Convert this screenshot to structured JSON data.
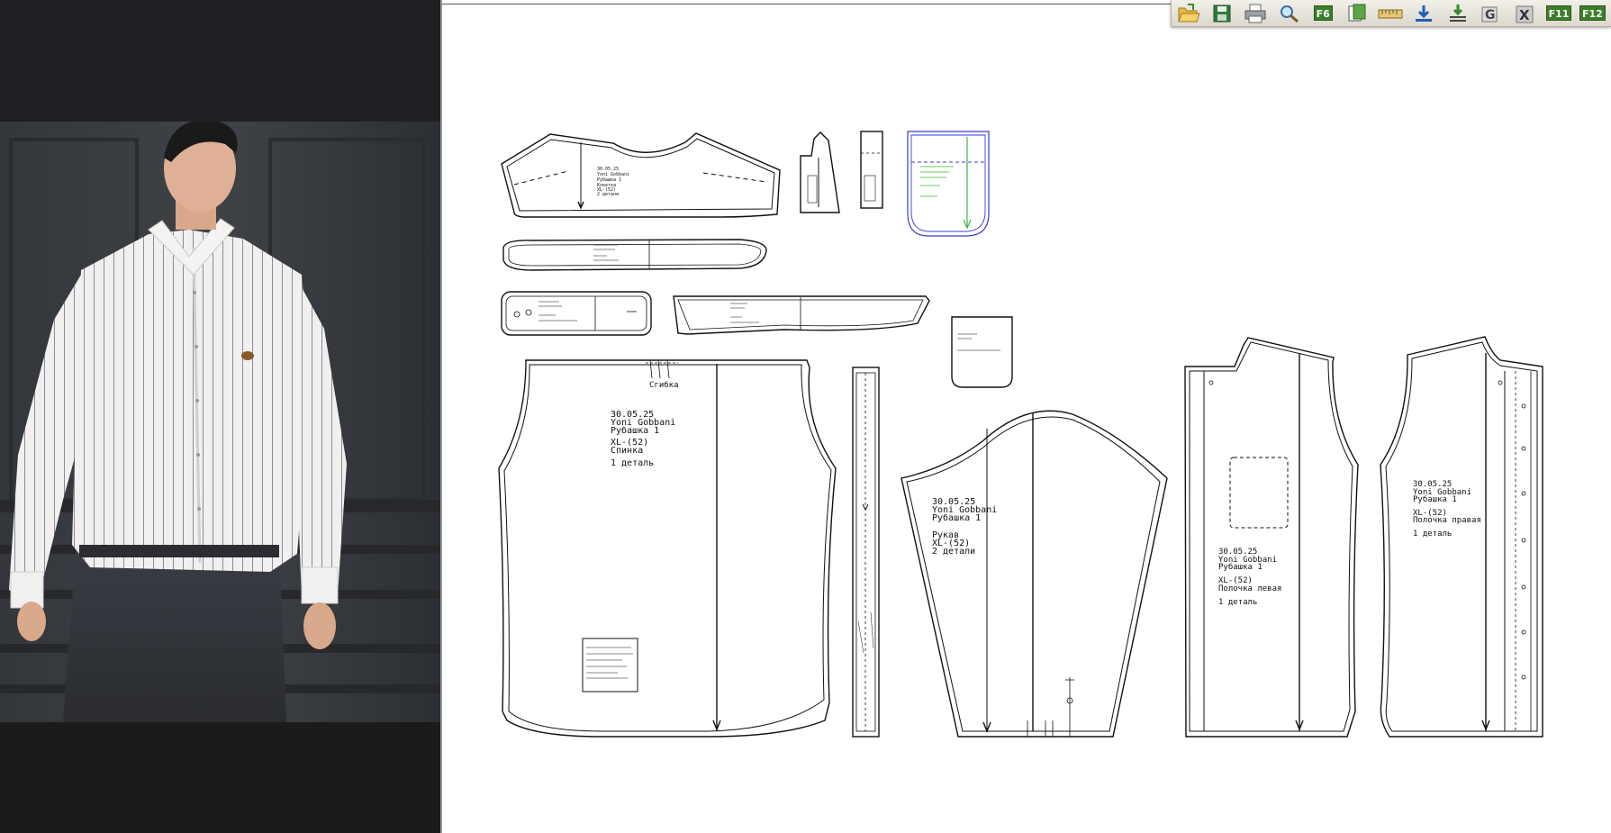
{
  "toolbar": {
    "buttons": [
      {
        "name": "open-folder-icon"
      },
      {
        "name": "save-icon"
      },
      {
        "name": "print-icon"
      },
      {
        "name": "magnifier-icon"
      },
      {
        "name": "f6-key",
        "key": "F6"
      },
      {
        "name": "copy-sheet-icon"
      },
      {
        "name": "measure-ruler-icon"
      },
      {
        "name": "import-download-icon"
      },
      {
        "name": "import-layers-icon"
      },
      {
        "name": "graded-g-icon"
      },
      {
        "name": "excel-x-icon"
      },
      {
        "name": "f11-key",
        "key": "F11"
      },
      {
        "name": "f12-key",
        "key": "F12"
      }
    ],
    "colors": {
      "f_key_bg": "#3c7d2a",
      "accent": "#2a7de1"
    }
  },
  "pattern_pieces": {
    "back": {
      "fold": "Сгибка",
      "lines": [
        "30.05.25",
        "Yoni Gobbani",
        "Рубашка 1",
        "XL-(52)",
        "Спинка",
        "1 деталь"
      ]
    },
    "sleeve": {
      "lines": [
        "30.05.25",
        "Yoni Gobbani",
        "Рубашка 1",
        "Рукав",
        "XL-(52)",
        "2 детали"
      ]
    },
    "front_left": {
      "lines": [
        "30.05.25",
        "Yoni Gobbani",
        "Рубашка 1",
        "XL-(52)",
        "Полочка левая",
        "1 деталь"
      ]
    },
    "front_right": {
      "lines": [
        "30.05.25",
        "Yoni Gobbani",
        "Рубашка 1",
        "XL-(52)",
        "Полочка правая",
        "1 деталь"
      ]
    },
    "yoke": {
      "lines": [
        "30.05.25",
        "Yoni Gobbani",
        "Рубашка 1",
        "XL-(52)",
        "Кокетка",
        "2 детали"
      ]
    }
  },
  "colors": {
    "pocket_outline": "#3a3ad0",
    "pocket_grain": "#3ab83a",
    "canvas_bg": "#ffffff",
    "left_panel_bg": "#1b1b1b"
  }
}
